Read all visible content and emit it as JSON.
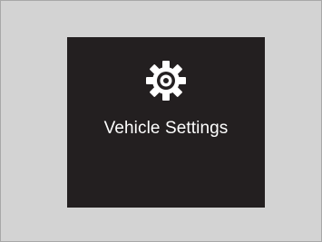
{
  "screen": {
    "icon": "gear-icon",
    "label": "Vehicle Settings",
    "background_color": "#231f20",
    "text_color": "#ffffff"
  },
  "frame": {
    "background_color": "#d3d3d3"
  }
}
